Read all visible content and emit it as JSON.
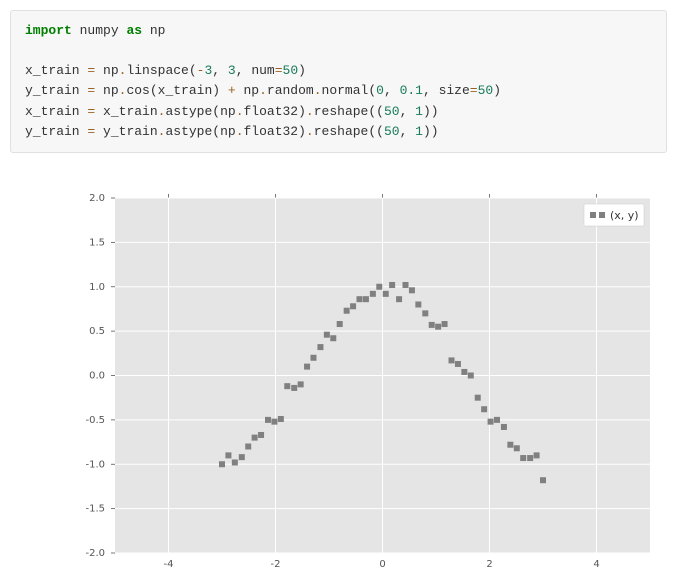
{
  "code": {
    "line1_import": "import",
    "line1_numpy": "numpy",
    "line1_as": "as",
    "line1_np": "np",
    "line3_pre": "x_train ",
    "line3_eq": "=",
    "line3_a": " np",
    "line3_dot1": ".",
    "line3_b": "linspace(",
    "line3_n1": "-3",
    "line3_c": ", ",
    "line3_n2": "3",
    "line3_d": ", num",
    "line3_eq2": "=",
    "line3_n3": "50",
    "line3_e": ")",
    "line4_pre": "y_train ",
    "line4_eq": "=",
    "line4_a": " np",
    "line4_dot1": ".",
    "line4_b": "cos(x_train) ",
    "line4_plus": "+",
    "line4_c": " np",
    "line4_dot2": ".",
    "line4_d": "random",
    "line4_dot3": ".",
    "line4_e": "normal(",
    "line4_n1": "0",
    "line4_f": ", ",
    "line4_n2": "0.1",
    "line4_g": ", size",
    "line4_eq2": "=",
    "line4_n3": "50",
    "line4_h": ")",
    "line5_pre": "x_train ",
    "line5_eq": "=",
    "line5_a": " x_train",
    "line5_dot1": ".",
    "line5_b": "astype(np",
    "line5_dot2": ".",
    "line5_c": "float32)",
    "line5_dot3": ".",
    "line5_d": "reshape((",
    "line5_n1": "50",
    "line5_e": ", ",
    "line5_n2": "1",
    "line5_f": "))",
    "line6_pre": "y_train ",
    "line6_eq": "=",
    "line6_a": " y_train",
    "line6_dot1": ".",
    "line6_b": "astype(np",
    "line6_dot2": ".",
    "line6_c": "float32)",
    "line6_dot3": ".",
    "line6_d": "reshape((",
    "line6_n1": "50",
    "line6_e": ", ",
    "line6_n2": "1",
    "line6_f": "))"
  },
  "chart_data": {
    "type": "scatter",
    "title": "",
    "xlabel": "",
    "ylabel": "",
    "xlim": [
      -5,
      5
    ],
    "ylim": [
      -2.0,
      2.0
    ],
    "xticks": [
      -4,
      -2,
      0,
      2,
      4
    ],
    "yticks": [
      -2.0,
      -1.5,
      -1.0,
      -0.5,
      0.0,
      0.5,
      1.0,
      1.5,
      2.0
    ],
    "legend": "(x, y)",
    "legend_position": "upper right",
    "grid": true,
    "series": [
      {
        "name": "(x, y)",
        "marker": "square",
        "color": "#808080",
        "x": [
          -3.0,
          -2.88,
          -2.76,
          -2.63,
          -2.51,
          -2.39,
          -2.27,
          -2.14,
          -2.02,
          -1.9,
          -1.78,
          -1.65,
          -1.53,
          -1.41,
          -1.29,
          -1.16,
          -1.04,
          -0.92,
          -0.8,
          -0.67,
          -0.55,
          -0.43,
          -0.31,
          -0.18,
          -0.06,
          0.06,
          0.18,
          0.31,
          0.43,
          0.55,
          0.67,
          0.8,
          0.92,
          1.04,
          1.16,
          1.29,
          1.41,
          1.53,
          1.65,
          1.78,
          1.9,
          2.02,
          2.14,
          2.27,
          2.39,
          2.51,
          2.63,
          2.76,
          2.88,
          3.0
        ],
        "y": [
          -1.0,
          -0.9,
          -0.98,
          -0.92,
          -0.8,
          -0.7,
          -0.67,
          -0.5,
          -0.52,
          -0.49,
          -0.12,
          -0.14,
          -0.1,
          0.1,
          0.2,
          0.32,
          0.46,
          0.42,
          0.58,
          0.73,
          0.78,
          0.86,
          0.86,
          0.92,
          1.0,
          0.92,
          1.02,
          0.86,
          1.02,
          0.96,
          0.8,
          0.7,
          0.57,
          0.55,
          0.58,
          0.17,
          0.13,
          0.04,
          0.0,
          -0.25,
          -0.38,
          -0.52,
          -0.5,
          -0.58,
          -0.78,
          -0.82,
          -0.93,
          -0.93,
          -0.9,
          -1.18
        ]
      }
    ]
  }
}
